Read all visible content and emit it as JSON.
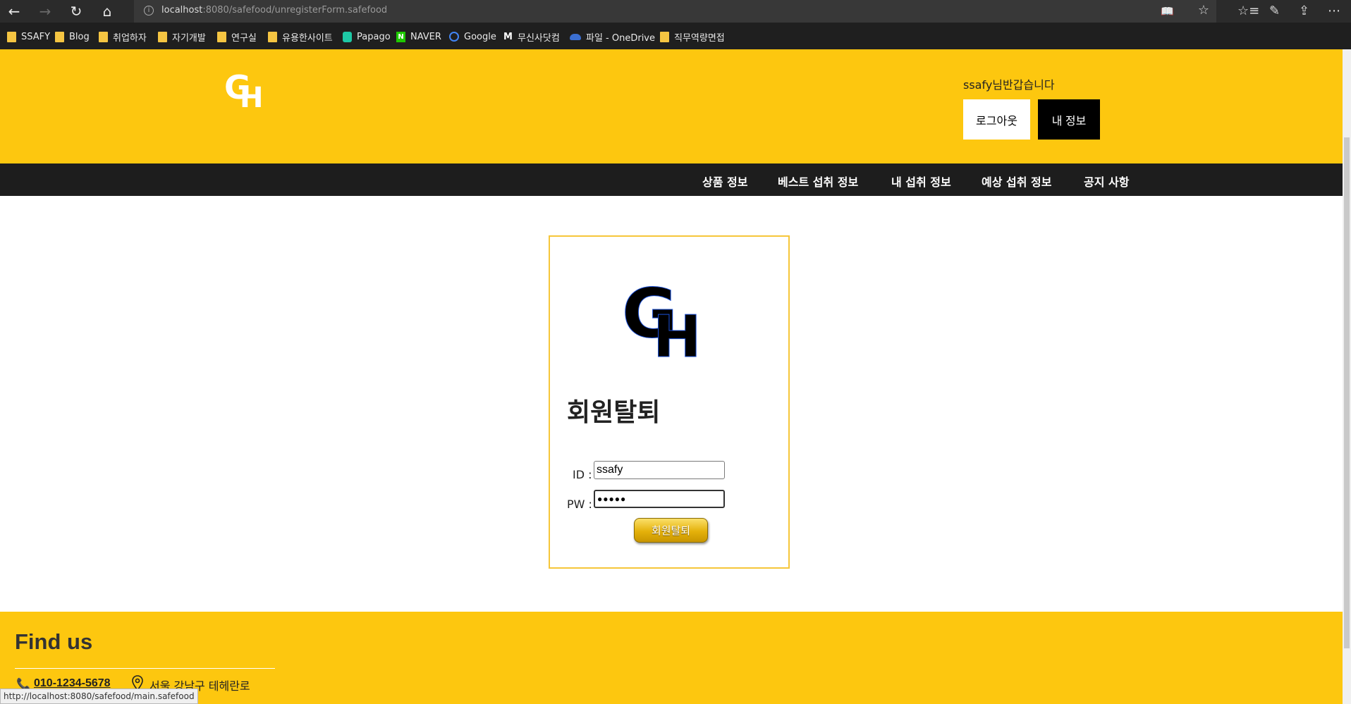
{
  "browser": {
    "url_host": "localhost",
    "url_rest": ":8080/safefood/unregisterForm.safefood",
    "status_url": "http://localhost:8080/safefood/main.safefood"
  },
  "bookmarks": [
    "SSAFY",
    "Blog",
    "취업하자",
    "자기개발",
    "연구실",
    "유용한사이트",
    "Papago",
    "NAVER",
    "Google",
    "무신사닷컴",
    "파일 - OneDrive",
    "직무역량면접"
  ],
  "header": {
    "greeting": "ssafy님반갑습니다",
    "logout_label": "로그아웃",
    "myinfo_label": "내 정보",
    "logo_text": "GH"
  },
  "menu": [
    "상품 정보",
    "베스트 섭취 정보",
    "내 섭취 정보",
    "예상 섭취 정보",
    "공지 사항"
  ],
  "form": {
    "title": "회원탈퇴",
    "id_label": "ID :",
    "id_value": "ssafy",
    "pw_label": "PW :",
    "pw_value": "●●●●●",
    "submit_label": "회원탈퇴"
  },
  "footer": {
    "title": "Find us",
    "phone": "010-1234-5678",
    "address": "서울 강남구 테헤란로"
  },
  "colors": {
    "brand_yellow": "#fdc70f",
    "menu_dark": "#1d1d1d"
  }
}
